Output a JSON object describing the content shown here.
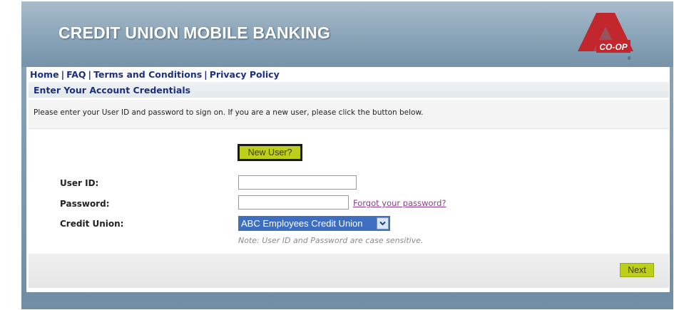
{
  "header": {
    "title": "CREDIT UNION MOBILE BANKING",
    "logo_text": "CO-OP"
  },
  "nav": {
    "items": [
      "Home",
      "FAQ",
      "Terms and Conditions",
      "Privacy Policy"
    ],
    "separator": "|"
  },
  "section": {
    "title": "Enter Your Account Credentials",
    "instructions": "Please enter your User ID and password to sign on. If you are a new user, please click the button below."
  },
  "form": {
    "new_user_button": "New User?",
    "user_id_label": "User ID:",
    "user_id_value": "",
    "password_label": "Password:",
    "password_value": "",
    "forgot_link": "Forgot your password?",
    "credit_union_label": "Credit Union:",
    "credit_union_selected": "ABC Employees Credit Union",
    "note": "Note: User ID and Password are case sensitive.",
    "next_button": "Next"
  },
  "colors": {
    "accent_button": "#bccf1a",
    "nav_text": "#1d2f7f",
    "logo_red": "#c1272d"
  }
}
